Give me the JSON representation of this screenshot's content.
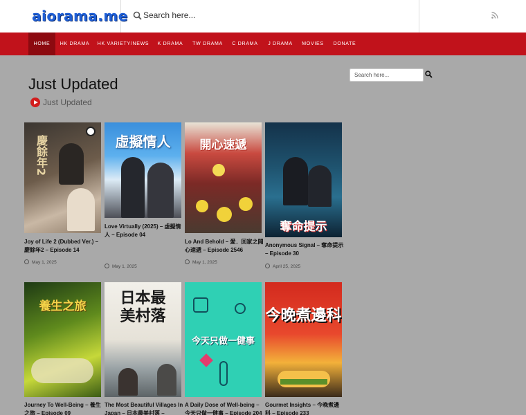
{
  "header": {
    "logo_text": "aiorama.me",
    "search_placeholder": "Search here..."
  },
  "nav": {
    "items": [
      {
        "label": "HOME",
        "active": true
      },
      {
        "label": "HK DRAMA"
      },
      {
        "label": "HK VARIETY/NEWS"
      },
      {
        "label": "K DRAMA"
      },
      {
        "label": "TW DRAMA"
      },
      {
        "label": "C DRAMA"
      },
      {
        "label": "J DRAMA"
      },
      {
        "label": "MOVIES"
      },
      {
        "label": "DONATE"
      }
    ]
  },
  "main": {
    "title": "Just Updated",
    "subtitle": "Just Updated"
  },
  "sidebar": {
    "search_placeholder": "Search here..."
  },
  "cards": [
    {
      "title": "Joy of Life 2 (Dubbed Ver.) – 慶餘年2 – Episode 14",
      "date": "May 1, 2025",
      "poster_text": "慶餘年2"
    },
    {
      "title": "Love Virtually (2025) – 虛擬情人 – Episode 04",
      "date": "May 1, 2025",
      "poster_text": "虛擬情人"
    },
    {
      "title": "Lo And Behold – 愛．回家之開心速遞 – Episode 2546",
      "date": "May 1, 2025",
      "poster_text": "開心速遞"
    },
    {
      "title": "Anonymous Signal – 奪命提示 – Episode 30",
      "date": "April 25, 2025",
      "poster_text": "奪命提示"
    },
    {
      "title": "Journey To Well-Being – 養生之旅 – Episode 09",
      "date": "",
      "poster_text": "養生之旅"
    },
    {
      "title": "The Most Beautiful Villages In Japan – 日本最美村落 – Episode",
      "date": "",
      "poster_text": "日本最美村落"
    },
    {
      "title": "A Daily Dose of Well-being – 今天只做一健事 – Episode 204",
      "date": "",
      "poster_text": "今天只做一健事"
    },
    {
      "title": "Gourmet Insights – 今晚煮邊科 – Episode 233",
      "date": "",
      "poster_text": "今晚煮邊科"
    }
  ]
}
